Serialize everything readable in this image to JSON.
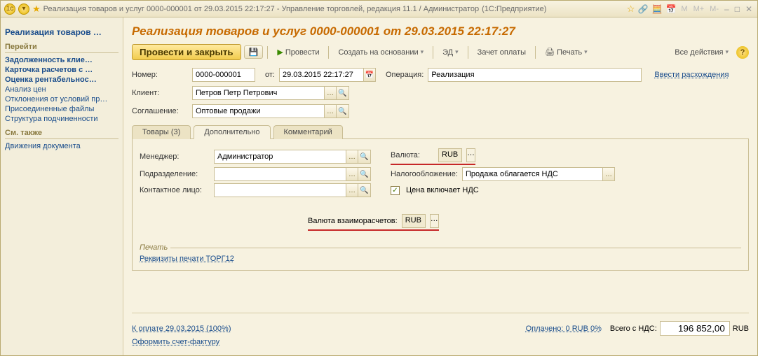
{
  "titlebar": {
    "title": "Реализация товаров и услуг 0000-000001 от 29.03.2015 22:17:27 - Управление торговлей, редакция 11.1 / Администратор",
    "mode": "(1С:Предприятие)",
    "m_buttons": [
      "M",
      "M+",
      "M-"
    ]
  },
  "sidebar": {
    "main_heading": "Реализация товаров …",
    "nav_title": "Перейти",
    "nav_items_bold": [
      "Задолженность клие…",
      "Карточка расчетов с …",
      "Оценка рентабельнос…"
    ],
    "nav_items": [
      "Анализ цен",
      "Отклонения от условий пр…",
      "Присоединенные файлы",
      "Структура подчиненности"
    ],
    "seealso_title": "См. также",
    "seealso_items": [
      "Движения документа"
    ]
  },
  "content": {
    "page_title": "Реализация товаров и услуг 0000-000001 от 29.03.2015 22:17:27",
    "toolbar": {
      "primary": "Провести и закрыть",
      "provesti": "Провести",
      "create_on_basis": "Создать на основании",
      "ed": "ЭД",
      "zachet": "Зачет оплаты",
      "print": "Печать",
      "all_actions": "Все действия"
    },
    "fields": {
      "number_label": "Номер:",
      "number_value": "0000-000001",
      "date_label": "от:",
      "date_value": "29.03.2015 22:17:27",
      "operation_label": "Операция:",
      "operation_value": "Реализация",
      "discrepancy_link": "Ввести расхождения",
      "client_label": "Клиент:",
      "client_value": "Петров Петр Петрович",
      "agreement_label": "Соглашение:",
      "agreement_value": "Оптовые продажи"
    },
    "tabs": {
      "t0": "Товары (3)",
      "t1": "Дополнительно",
      "t2": "Комментарий"
    },
    "additional": {
      "manager_label": "Менеджер:",
      "manager_value": "Администратор",
      "currency_label": "Валюта:",
      "currency_value": "RUB",
      "department_label": "Подразделение:",
      "department_value": "",
      "tax_label": "Налогообложение:",
      "tax_value": "Продажа облагается НДС",
      "contact_label": "Контактное лицо:",
      "contact_value": "",
      "price_includes_vat": "Цена включает НДС",
      "settlement_currency_label": "Валюта взаиморасчетов:",
      "settlement_currency_value": "RUB",
      "print_section_title": "Печать",
      "print_link": "Реквизиты печати ТОРГ12"
    },
    "footer": {
      "to_pay_link": "К оплате 29.03.2015 (100%)",
      "paid_link": "Оплачено: 0 RUB  0%",
      "total_label": "Всего с НДС:",
      "total_value": "196 852,00",
      "currency": "RUB",
      "invoice_link": "Оформить счет-фактуру"
    }
  }
}
